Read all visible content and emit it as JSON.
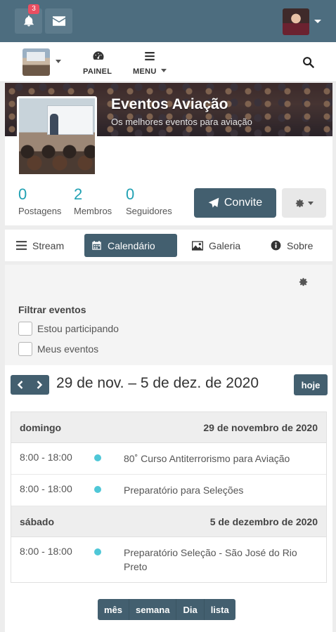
{
  "topbar": {
    "notifications_badge": "3",
    "icons": {
      "notifications": "bell-icon",
      "messages": "envelope-icon"
    }
  },
  "navbar": {
    "panel_label": "PAINEL",
    "menu_label": "MENU",
    "icons": {
      "panel": "dashboard-icon",
      "menu": "bars-icon",
      "search": "search-icon"
    }
  },
  "space": {
    "title": "Eventos Aviação",
    "subtitle": "Os melhores eventos para aviação"
  },
  "stats": [
    {
      "value": "0",
      "label": "Postagens"
    },
    {
      "value": "2",
      "label": "Membros"
    },
    {
      "value": "0",
      "label": "Seguidores"
    }
  ],
  "actions": {
    "invite_label": "Convite"
  },
  "tabs": [
    {
      "label": "Stream",
      "icon": "list-icon"
    },
    {
      "label": "Calendário",
      "icon": "calendar-icon",
      "active": true
    },
    {
      "label": "Galeria",
      "icon": "image-icon"
    },
    {
      "label": "Sobre",
      "icon": "info-icon"
    }
  ],
  "filter": {
    "title": "Filtrar eventos",
    "options": [
      "Estou participando",
      "Meus eventos"
    ]
  },
  "calendar": {
    "range_title": "29 de nov. – 5 de dez. de 2020",
    "today_label": "hoje",
    "days": [
      {
        "weekday": "domingo",
        "date": "29 de novembro de 2020",
        "events": [
          {
            "time": "8:00 - 18:00",
            "title": "80˚ Curso Antiterrorismo para Aviação"
          },
          {
            "time": "8:00 - 18:00",
            "title": "Preparatório para Seleções"
          }
        ]
      },
      {
        "weekday": "sábado",
        "date": "5 de dezembro de 2020",
        "events": [
          {
            "time": "8:00 - 18:00",
            "title": "Preparatório Seleção - São José do Rio Preto"
          }
        ]
      }
    ],
    "views": [
      "mês",
      "semana",
      "Dia",
      "lista"
    ]
  },
  "colors": {
    "primary": "#435f6f",
    "topbar": "#4d6d7f",
    "accent": "#21a1b3",
    "event_dot": "#4fc7d7",
    "badge": "#e94e61"
  }
}
